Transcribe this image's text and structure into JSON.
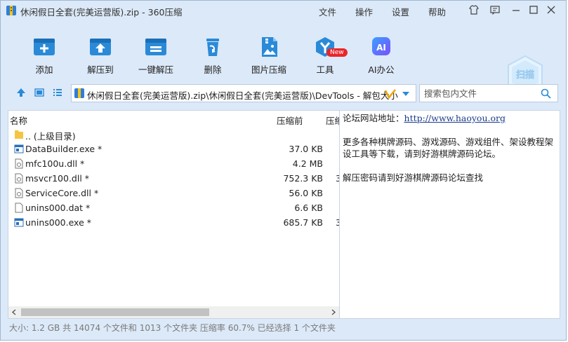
{
  "window": {
    "title": "休闲假日全套(完美运营版).zip - 360压缩",
    "menu": [
      "文件",
      "操作",
      "设置",
      "帮助"
    ]
  },
  "toolbar": {
    "items": [
      {
        "label": "添加",
        "icon": "add-icon"
      },
      {
        "label": "解压到",
        "icon": "extract-to-icon"
      },
      {
        "label": "一键解压",
        "icon": "one-click-extract-icon"
      },
      {
        "label": "删除",
        "icon": "delete-icon"
      },
      {
        "label": "图片压缩",
        "icon": "image-compress-icon"
      },
      {
        "label": "工具",
        "icon": "tools-icon"
      },
      {
        "label": "AI办公",
        "icon": "ai-office-icon"
      }
    ],
    "badge": "New",
    "scan_label": "扫描"
  },
  "address": {
    "path": "休闲假日全套(完美运营版).zip\\休闲假日全套(完美运营版)\\DevTools - 解包大小",
    "search_placeholder": "搜索包内文件"
  },
  "file_list": {
    "columns": [
      "名称",
      "压缩前",
      "压缩"
    ],
    "rows": [
      {
        "name": ".. (上级目录)",
        "size": "",
        "type": "folder"
      },
      {
        "name": "DataBuilder.exe *",
        "size": "37.0 KB",
        "type": "exe"
      },
      {
        "name": "mfc100u.dll *",
        "size": "4.2 MB",
        "type": "dll"
      },
      {
        "name": "msvcr100.dll *",
        "size": "752.3 KB",
        "type": "dll"
      },
      {
        "name": "ServiceCore.dll *",
        "size": "56.0 KB",
        "type": "dll"
      },
      {
        "name": "unins000.dat *",
        "size": "6.6 KB",
        "type": "file"
      },
      {
        "name": "unins000.exe *",
        "size": "685.7 KB",
        "type": "exe"
      }
    ],
    "clipped_digit": "3"
  },
  "info": {
    "site_label": "论坛网站地址：",
    "site_url": "http://www.haoyou.org",
    "para1": "更多各种棋牌源码、游戏源码、游戏组件、架设教程架设工具等下载，请到好游棋牌源码论坛。",
    "para2": "解压密码请到好游棋牌源码论坛查找"
  },
  "status": {
    "text": "大小: 1.2 GB 共 14074 个文件和 1013 个文件夹 压缩率 60.7% 已经选择 1 个文件夹"
  },
  "colors": {
    "accent": "#2a8ad8",
    "window_bg": "#dce9f8"
  }
}
